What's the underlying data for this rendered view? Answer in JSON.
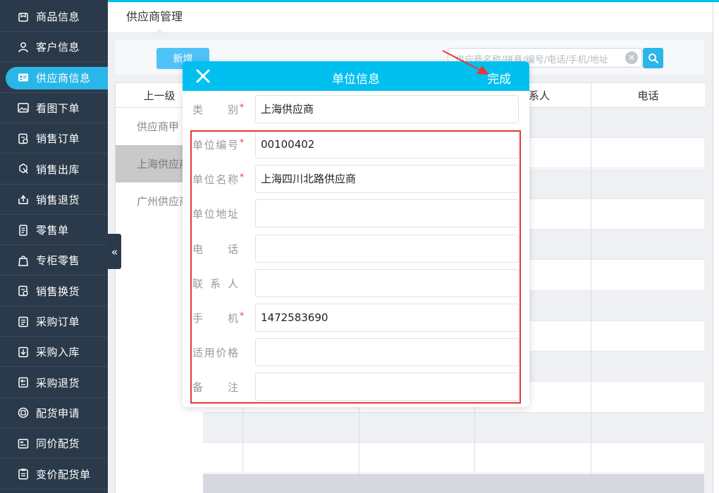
{
  "sidebar": {
    "items": [
      {
        "label": "商品信息",
        "icon": "box-icon"
      },
      {
        "label": "客户信息",
        "icon": "user-icon"
      },
      {
        "label": "供应商信息",
        "icon": "id-card-icon"
      },
      {
        "label": "看图下单",
        "icon": "image-icon"
      },
      {
        "label": "销售订单",
        "icon": "order-icon"
      },
      {
        "label": "销售出库",
        "icon": "export-icon"
      },
      {
        "label": "销售退货",
        "icon": "return-icon"
      },
      {
        "label": "零售单",
        "icon": "receipt-icon"
      },
      {
        "label": "专柜零售",
        "icon": "bag-icon"
      },
      {
        "label": "销售换货",
        "icon": "exchange-icon"
      },
      {
        "label": "采购订单",
        "icon": "purchase-order-icon"
      },
      {
        "label": "采购入库",
        "icon": "import-icon"
      },
      {
        "label": "采购退货",
        "icon": "purchase-return-icon"
      },
      {
        "label": "配货申请",
        "icon": "dispatch-icon"
      },
      {
        "label": "同价配货",
        "icon": "same-price-icon"
      },
      {
        "label": "变价配货单",
        "icon": "price-change-icon"
      }
    ],
    "active_index": 2
  },
  "header": {
    "title": "供应商管理"
  },
  "toolbar": {
    "add_label": "新增",
    "search_placeholder": "供应商名称/拼音/编号/电话/手机/地址"
  },
  "table": {
    "columns": [
      "上一级",
      "系人",
      "电话"
    ],
    "tree_items": [
      "供应商甲",
      "上海供应商",
      "广州供应商"
    ],
    "selected_tree_index": 1
  },
  "modal": {
    "title": "单位信息",
    "done_label": "完成",
    "fields": [
      {
        "label": "类别",
        "required": true,
        "value": ""
      },
      {
        "label": "单位编号",
        "required": true,
        "value": "00100402"
      },
      {
        "label": "单位名称",
        "required": true,
        "value": "上海四川北路供应商"
      },
      {
        "label": "单位地址",
        "required": false,
        "value": ""
      },
      {
        "label": "电话",
        "required": false,
        "value": ""
      },
      {
        "label": "联系人",
        "required": false,
        "value": ""
      },
      {
        "label": "手机",
        "required": true,
        "value": "1472583690"
      },
      {
        "label": "适用价格",
        "required": false,
        "value": ""
      },
      {
        "label": "备注",
        "required": false,
        "value": ""
      }
    ],
    "category_value": "上海供应商"
  },
  "colors": {
    "sidebar_bg": "#2b3a4a",
    "accent": "#00c0ef",
    "active_pill": "#29b6e8",
    "highlight_red": "#e53935"
  }
}
